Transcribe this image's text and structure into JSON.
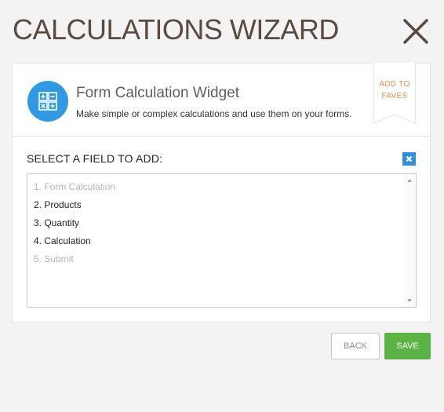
{
  "wizard": {
    "title": "CALCULATIONS WIZARD",
    "close_icon": "close-icon"
  },
  "widget": {
    "name": "Form Calculation Widget",
    "description": "Make simple or complex calculations and use them on your forms.",
    "icon": "calculator-icon",
    "icon_color": "#2f9ae3",
    "faves_line1": "ADD TO",
    "faves_line2": "FAVES",
    "faves_color": "#e0904f"
  },
  "field_select": {
    "label": "SELECT A FIELD TO ADD:",
    "clear_icon": "clear-icon",
    "items": [
      {
        "label": "1. Form Calculation",
        "enabled": false
      },
      {
        "label": "2. Products",
        "enabled": true
      },
      {
        "label": "3. Quantity",
        "enabled": true
      },
      {
        "label": "4. Calculation",
        "enabled": true
      },
      {
        "label": "5. Submit",
        "enabled": false
      }
    ]
  },
  "footer": {
    "back_label": "BACK",
    "save_label": "SAVE",
    "save_color": "#5cb345"
  }
}
